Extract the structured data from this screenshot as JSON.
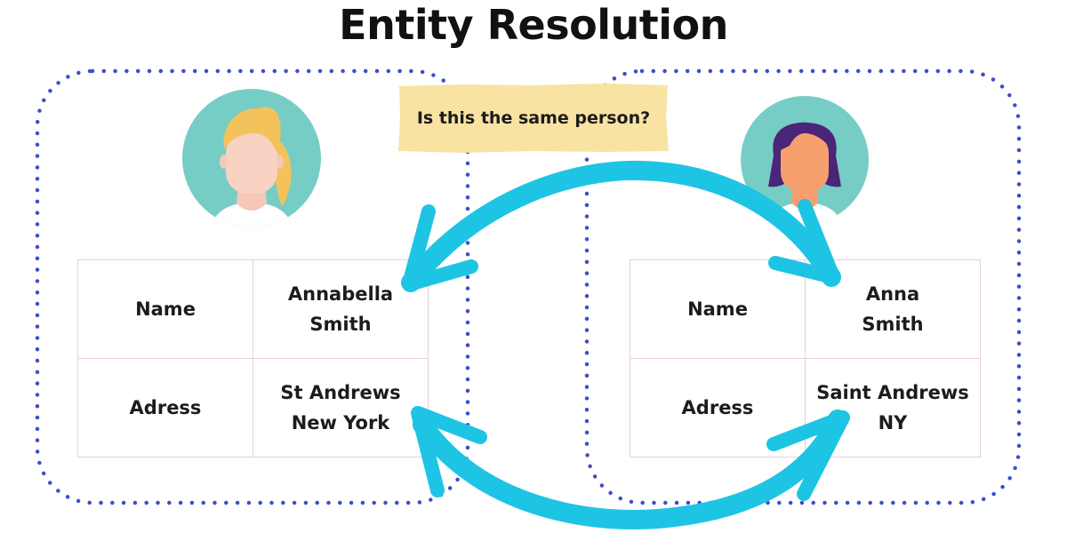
{
  "title": "Entity Resolution",
  "question": "Is this the same person?",
  "colors": {
    "arrow": "#1ec4e4",
    "dotted_border": "#3a4fc8",
    "question_bg": "#f8e3a3",
    "avatar_bg": "#76cdc6",
    "table_border": "#e7cfdc"
  },
  "records": [
    {
      "side": "left",
      "avatar": {
        "icon": "woman-blonde-avatar-icon",
        "hair": "#f4c25a",
        "skin": "#f8d2c2"
      },
      "rows": [
        {
          "label": "Name",
          "value": "Annabella\nSmith"
        },
        {
          "label": "Adress",
          "value": "St Andrews\nNew York"
        }
      ]
    },
    {
      "side": "right",
      "avatar": {
        "icon": "woman-dark-hair-avatar-icon",
        "hair": "#4b2577",
        "skin": "#f6a06e"
      },
      "rows": [
        {
          "label": "Name",
          "value": "Anna\nSmith"
        },
        {
          "label": "Adress",
          "value": "Saint Andrews\nNY"
        }
      ]
    }
  ],
  "arrows": [
    {
      "name": "name-comparison-arrow",
      "from": "Annabella Smith",
      "to": "Anna Smith",
      "direction": "bidirectional"
    },
    {
      "name": "address-comparison-arrow",
      "from": "St Andrews New York",
      "to": "Saint Andrews NY",
      "direction": "bidirectional"
    }
  ]
}
